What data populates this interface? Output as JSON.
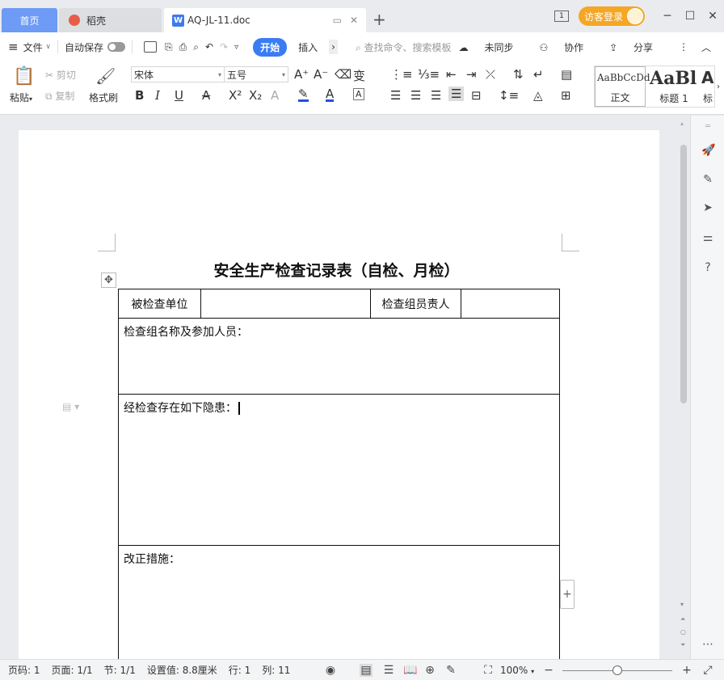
{
  "tabs": {
    "home": "首页",
    "docer": "稻壳",
    "doc": "AQ-JL-11.doc"
  },
  "topbar": {
    "page_indicator": "1",
    "login": "访客登录"
  },
  "menubar": {
    "file": "文件",
    "autosave": "自动保存",
    "start": "开始",
    "insert": "插入",
    "search_placeholder": "查找命令、搜索模板",
    "sync": "未同步",
    "collab": "协作",
    "share": "分享"
  },
  "ribbon": {
    "paste": "粘贴",
    "cut": "剪切",
    "copy": "复制",
    "format_painter": "格式刷",
    "font_name": "宋体",
    "font_size": "五号",
    "styles": [
      {
        "sample": "AaBbCcDd",
        "label": "正文"
      },
      {
        "sample": "AaBl",
        "label": "标题 1"
      },
      {
        "sample": "A",
        "label": "标"
      }
    ]
  },
  "document": {
    "title": "安全生产检查记录表（自检、月检）",
    "row1": {
      "label1": "被检查单位",
      "value1": "",
      "label2": "检查组员责人",
      "value2": ""
    },
    "group_label": "检查组名称及参加人员：",
    "hazards_label": "经检查存在如下隐患：",
    "measures_label": "改正措施："
  },
  "statusbar": {
    "page_num": "页码: 1",
    "pages": "页面: 1/1",
    "section": "节: 1/1",
    "setting": "设置值: 8.8厘米",
    "line": "行: 1",
    "col": "列: 11",
    "zoom": "100%"
  }
}
